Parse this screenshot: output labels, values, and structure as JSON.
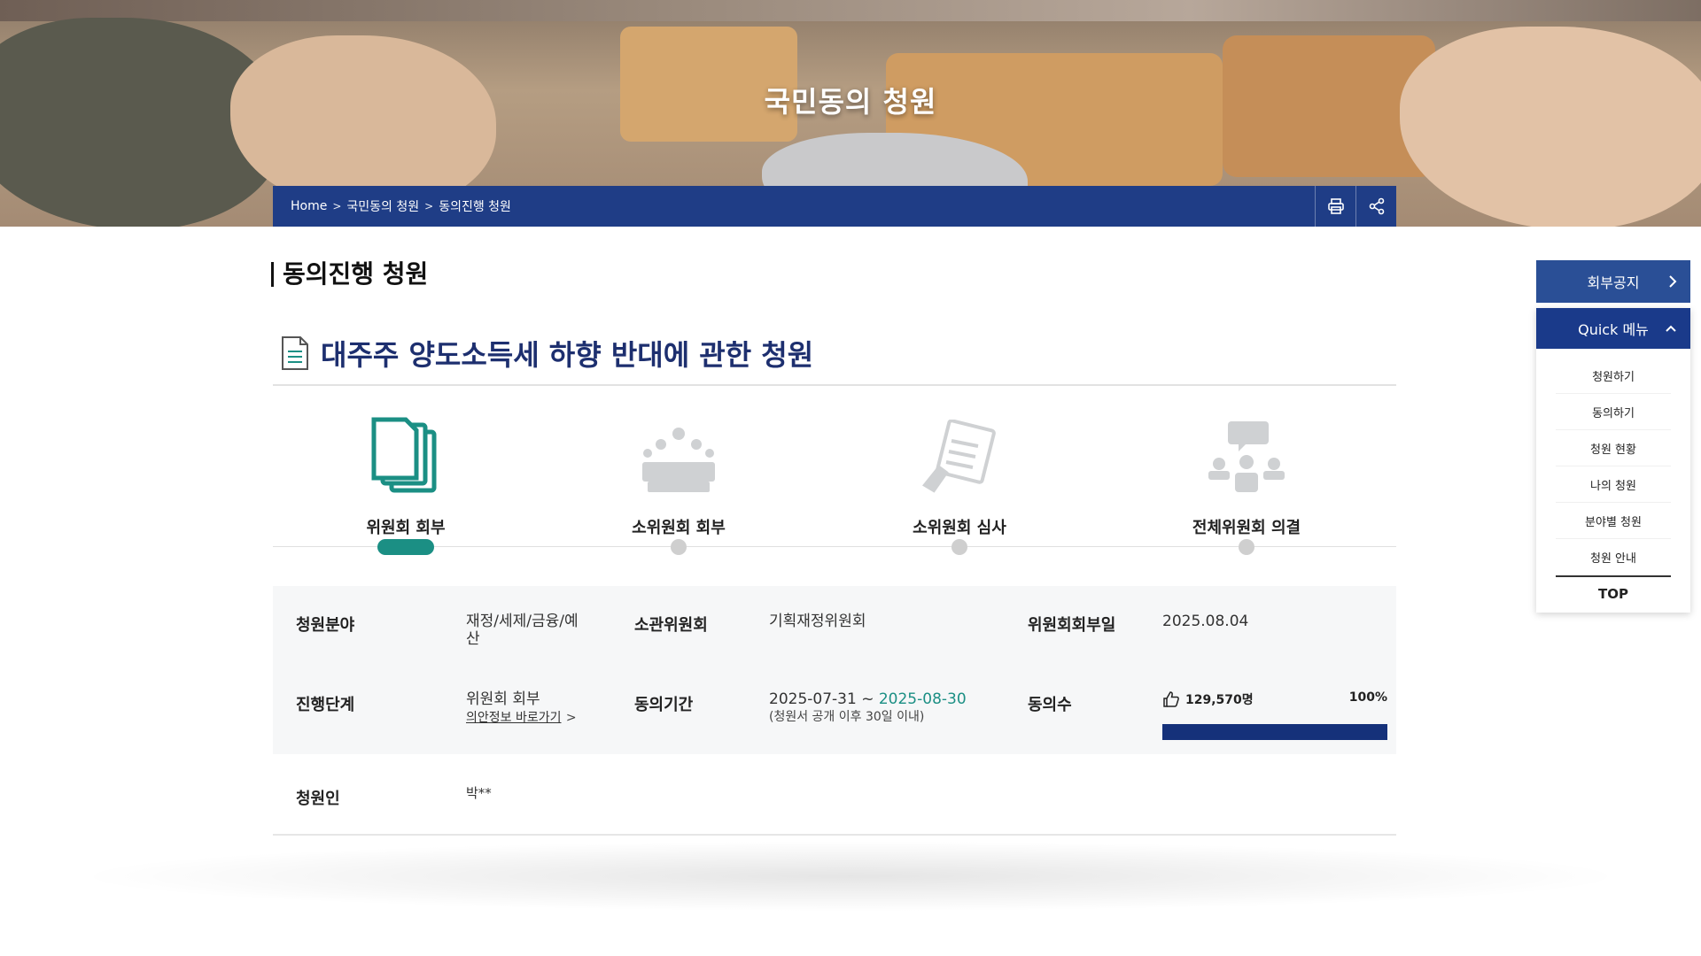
{
  "hero": {
    "title": "국민동의 청원"
  },
  "breadcrumb": {
    "home": "Home",
    "level1": "국민동의 청원",
    "level2": "동의진행 청원",
    "separator": ">"
  },
  "tools": {
    "print_icon": "printer-icon",
    "share_icon": "share-icon"
  },
  "page": {
    "section_title": "동의진행 청원",
    "petition_title": "대주주 양도소득세 하향 반대에 관한 청원"
  },
  "steps": [
    {
      "label": "위원회 회부",
      "icon": "documents-icon",
      "active": true
    },
    {
      "label": "소위원회 회부",
      "icon": "meeting-icon",
      "active": false
    },
    {
      "label": "소위원회 심사",
      "icon": "review-icon",
      "active": false
    },
    {
      "label": "전체위원회 의결",
      "icon": "assembly-icon",
      "active": false
    }
  ],
  "info": {
    "field_label": "청원분야",
    "field_value_line1": "재정/세제/금융/예",
    "field_value_line2": "산",
    "committee_label": "소관위원회",
    "committee_value": "기획재정위원회",
    "referral_date_label": "위원회회부일",
    "referral_date_value": "2025.08.04",
    "stage_label": "진행단계",
    "stage_value": "위원회 회부",
    "stage_link": "의안정보 바로가기",
    "stage_link_arrow": ">",
    "period_label": "동의기간",
    "period_start": "2025-07-31",
    "period_sep": " ~ ",
    "period_end": "2025-08-30",
    "period_note": "(청원서 공개 이후 30일 이내)",
    "agree_label": "동의수",
    "agree_count": "129,570명",
    "agree_percent_text": "100%",
    "agree_fraction": 1.0,
    "petitioner_label": "청원인",
    "petitioner_value": "박**"
  },
  "side": {
    "notice_label": "회부공지",
    "notice_chevron": "›",
    "quick_label": "Quick 메뉴",
    "quick_chevron": "˄",
    "quick_items": [
      "청원하기",
      "동의하기",
      "청원 현황",
      "나의 청원",
      "분야별 청원",
      "청원 안내"
    ],
    "top_label": "TOP"
  },
  "colors": {
    "accent_teal": "#1b8f84",
    "navy": "#1f3d86",
    "progress": "#15317a",
    "title_blue": "#1d2f6f"
  }
}
